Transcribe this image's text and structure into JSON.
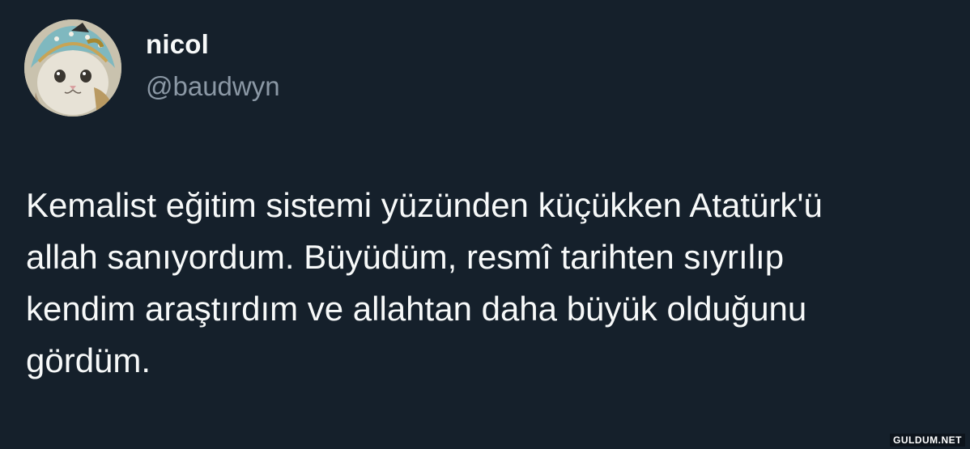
{
  "author": {
    "display_name": "nicol",
    "handle": "@baudwyn",
    "avatar_icon": "cat-with-bonnet-avatar"
  },
  "tweet": {
    "lines": [
      "Kemalist eğitim sistemi yüzünden küçükken Atatürk'ü",
      "allah sanıyordum. Büyüdüm, resmî tarihten sıyrılıp",
      "kendim araştırdım ve allahtan daha büyük olduğunu",
      "gördüm."
    ]
  },
  "watermark": "GULDUM.NET",
  "colors": {
    "background": "#15202b",
    "text": "#f7f9f9",
    "secondary_text": "#8b98a5"
  }
}
